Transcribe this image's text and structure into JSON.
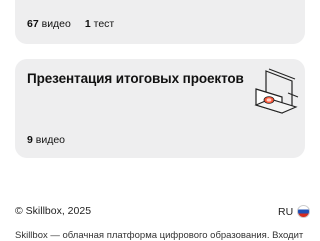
{
  "top_card": {
    "videos_count": "67",
    "videos_label": "видео",
    "tests_count": "1",
    "tests_label": "тест"
  },
  "main_card": {
    "title": "Презентация итоговых проектов",
    "videos_count": "9",
    "videos_label": "видео",
    "illustration_icon": "laptop-presentation-icon"
  },
  "footer": {
    "copyright": "© Skillbox, 2025",
    "language": "RU",
    "flag_icon": "russia-flag-icon",
    "description": "Skillbox — облачная платформа цифрового образования. Входит"
  },
  "colors": {
    "card_bg": "#eeeeef",
    "text": "#111111",
    "accent": "#ff5a3c"
  }
}
